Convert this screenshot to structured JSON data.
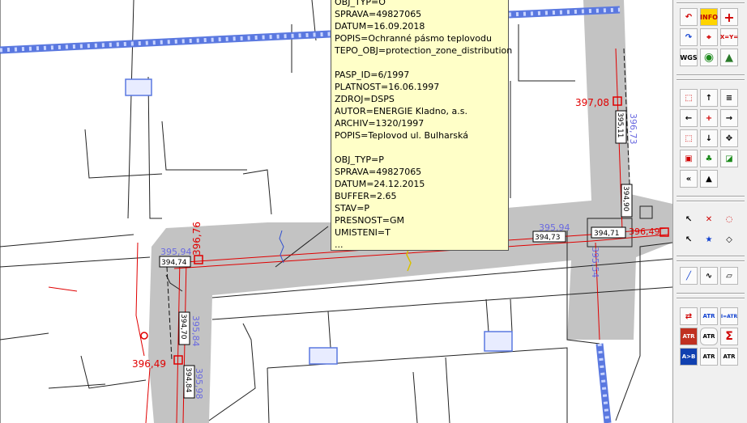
{
  "popup": {
    "lines": [
      "OBJ_TYP=O",
      "SPRAVA=49827065",
      "DATUM=16.09.2018",
      "POPIS=Ochranné pásmo teplovodu",
      "TEPO_OBJ=protection_zone_distribution",
      "",
      "PASP_ID=6/1997",
      "PLATNOST=16.06.1997",
      "ZDROJ=DSPS",
      "AUTOR=ENERGIE Kladno, a.s.",
      "ARCHIV=1320/1997",
      "POPIS=Teplovod ul. Bulharská",
      "",
      "OBJ_TYP=P",
      "SPRAVA=49827065",
      "DATUM=24.12.2015",
      "BUFFER=2.65",
      "STAV=P",
      "PRESNOST=GM",
      "UMISTENI=T",
      "..."
    ]
  },
  "map_labels": {
    "red_elev_1": "396,76",
    "red_elev_2": "396,49",
    "red_elev_3": "397,08",
    "red_elev_4": "396,49",
    "blue_elev_1": "395,94",
    "blue_elev_2": "395,94",
    "blue_elev_3": "395,84",
    "blue_elev_4": "395,98",
    "blue_elev_5": "395,54",
    "blue_elev_6": "396,73",
    "box_1": "394,74",
    "box_2": "394,73",
    "box_3": "394,71",
    "box_4": "394,70",
    "box_5": "394,84",
    "box_6": "395,11",
    "box_7": "394,90"
  },
  "toolbar": {
    "info_label": "INFO",
    "wgs_label": "WGS",
    "xy_label": "X=Y=",
    "atr_label": "ATR",
    "iatr_label": "I=ATR",
    "ab_label": "A>B",
    "sigma_label": "Σ"
  },
  "colors": {
    "popup_bg": "#ffffc8",
    "road_gray": "#c3c3c3",
    "water_blue": "#5a78e0",
    "red": "#e00000",
    "blue_text": "#6a6ae0"
  }
}
